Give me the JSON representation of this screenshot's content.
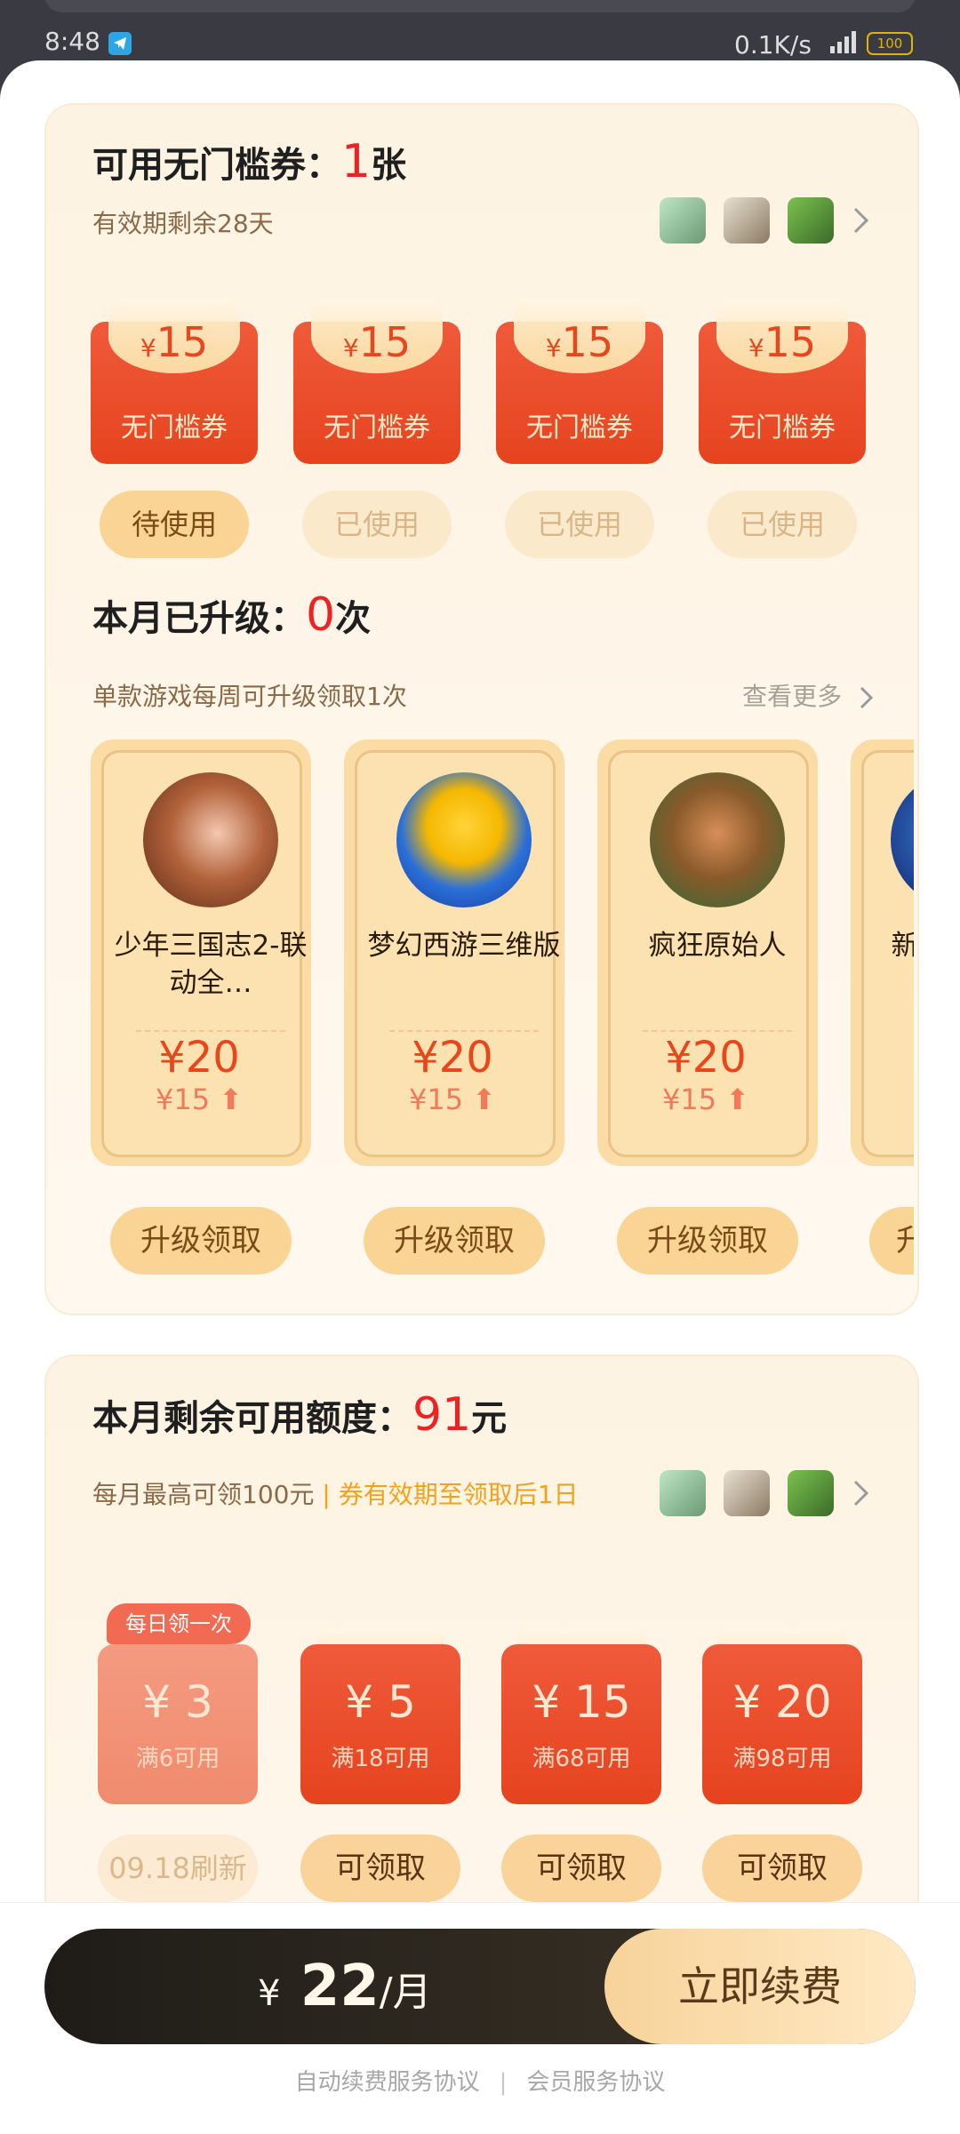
{
  "status_bar": {
    "time": "8:48",
    "net_speed": "0.1K/s",
    "battery": "100"
  },
  "card1": {
    "title_prefix": "可用无门槛券：",
    "count": "1",
    "title_suffix": "张",
    "validity": "有效期剩余28天",
    "coupons": [
      {
        "currency": "¥",
        "amount": "15",
        "label": "无门槛券",
        "status": "待使用"
      },
      {
        "currency": "¥",
        "amount": "15",
        "label": "无门槛券",
        "status": "已使用"
      },
      {
        "currency": "¥",
        "amount": "15",
        "label": "无门槛券",
        "status": "已使用"
      },
      {
        "currency": "¥",
        "amount": "15",
        "label": "无门槛券",
        "status": "已使用"
      }
    ],
    "upgrade_title_prefix": "本月已升级：",
    "upgrade_count": "0",
    "upgrade_title_suffix": "次",
    "upgrade_note": "单款游戏每周可升级领取1次",
    "view_more": "查看更多",
    "games": [
      {
        "name": "少年三国志2-联动全…",
        "price": "¥20",
        "old_price": "¥15",
        "button": "升级领取"
      },
      {
        "name": "梦幻西游三维版",
        "price": "¥20",
        "old_price": "¥15",
        "button": "升级领取"
      },
      {
        "name": "疯狂原始人",
        "price": "¥20",
        "old_price": "¥15",
        "button": "升级领取"
      },
      {
        "name": "新",
        "price": "",
        "old_price": "",
        "button": "升"
      }
    ]
  },
  "card2": {
    "title_prefix": "本月剩余可用额度：",
    "amount": "91",
    "title_suffix": "元",
    "note": "每月最高可领100元",
    "note_highlight": "| 券有效期至领取后1日",
    "daily_badge": "每日领一次",
    "coupons": [
      {
        "value": "¥ 3",
        "condition": "满6可用",
        "action": "09.18刷新"
      },
      {
        "value": "¥ 5",
        "condition": "满18可用",
        "action": "可领取"
      },
      {
        "value": "¥ 15",
        "condition": "满68可用",
        "action": "可领取"
      },
      {
        "value": "¥ 20",
        "condition": "满98可用",
        "action": "可领取"
      }
    ]
  },
  "footer": {
    "currency": "¥",
    "price": "22",
    "per": "/月",
    "renew_button": "立即续费",
    "link_auto": "自动续费服务协议",
    "link_sep": "|",
    "link_member": "会员服务协议"
  }
}
